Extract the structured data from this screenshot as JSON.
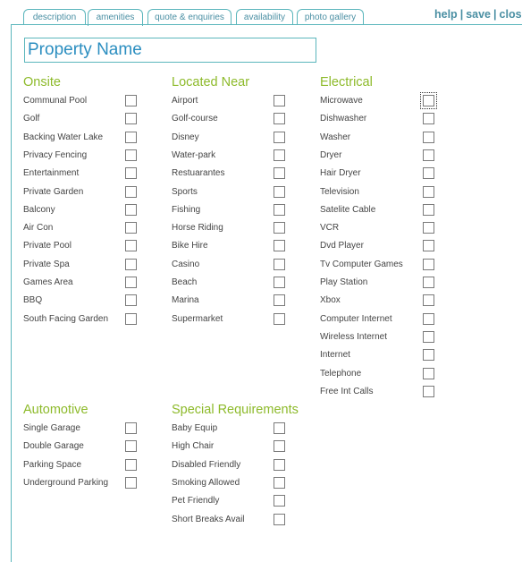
{
  "tabs": [
    {
      "label": "description",
      "active": false
    },
    {
      "label": "amenities",
      "active": true
    },
    {
      "label": "quote & enquiries",
      "active": false
    },
    {
      "label": "availability",
      "active": false
    },
    {
      "label": "photo gallery",
      "active": false
    }
  ],
  "toplinks": {
    "help": "help",
    "save": "save",
    "close": "close",
    "sep": "|"
  },
  "property_name": "Property Name",
  "onsite": {
    "title": "Onsite",
    "items": [
      "Communal Pool",
      "Golf",
      "Backing Water Lake",
      "Privacy Fencing",
      "Entertainment",
      "Private Garden",
      "Balcony",
      "Air Con",
      "Private Pool",
      "Private Spa",
      "Games Area",
      "BBQ",
      "South Facing Garden"
    ]
  },
  "located_near": {
    "title": "Located Near",
    "items": [
      "Airport",
      "Golf-course",
      "Disney",
      "Water-park",
      "Restuarantes",
      "Sports",
      "Fishing",
      "Horse Riding",
      "Bike Hire",
      "Casino",
      "Beach",
      "Marina",
      "Supermarket"
    ]
  },
  "electrical": {
    "title": "Electrical",
    "items": [
      "Microwave",
      "Dishwasher",
      "Washer",
      "Dryer",
      "Hair Dryer",
      "Television",
      "Satelite Cable",
      "VCR",
      "Dvd Player",
      "Tv Computer Games",
      "Play Station",
      "Xbox",
      "Computer Internet",
      "Wireless Internet",
      "Internet",
      "Telephone",
      "Free Int Calls"
    ]
  },
  "automotive": {
    "title": "Automotive",
    "items": [
      "Single Garage",
      "Double Garage",
      "Parking Space",
      "Underground Parking"
    ]
  },
  "special_requirements": {
    "title": "Special Requirements",
    "items": [
      "Baby Equip",
      "High Chair",
      "Disabled Friendly",
      "Smoking Allowed",
      "Pet Friendly",
      "Short Breaks Avail"
    ]
  }
}
